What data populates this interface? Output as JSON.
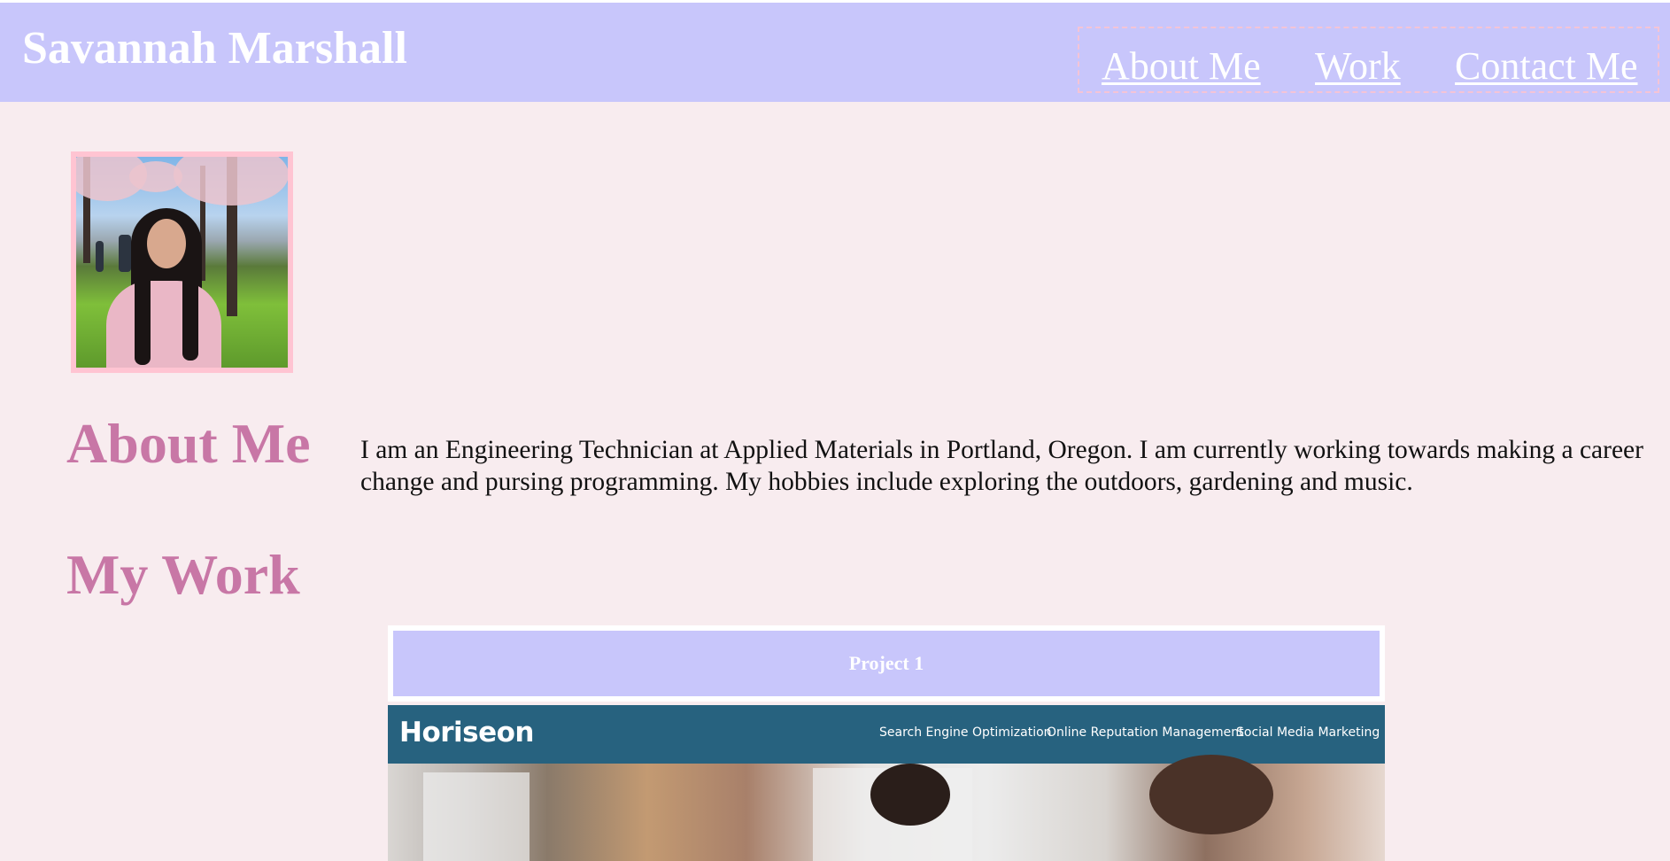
{
  "header": {
    "site_title": "Savannah Marshall",
    "nav": [
      {
        "label": "About Me"
      },
      {
        "label": "Work"
      },
      {
        "label": "Contact Me"
      }
    ]
  },
  "about": {
    "heading": "About Me",
    "text": "I am an Engineering Technician at Applied Materials in Portland, Oregon. I am currently working towards making a career change and pursing programming. My hobbies include exploring the outdoors, gardening and music."
  },
  "work": {
    "heading": "My Work",
    "projects": [
      {
        "label": "Project 1",
        "screenshot": {
          "logo": "Horiseon",
          "nav": [
            "Search Engine Optimization",
            "Online Reputation Management",
            "Social Media Marketing"
          ]
        }
      }
    ]
  },
  "colors": {
    "page_bg": "#f8ecef",
    "header_bg": "#c8c6fb",
    "heading_pink": "#c877a6",
    "photo_border": "#ffc4d2",
    "horiseon_header": "#27627f"
  }
}
